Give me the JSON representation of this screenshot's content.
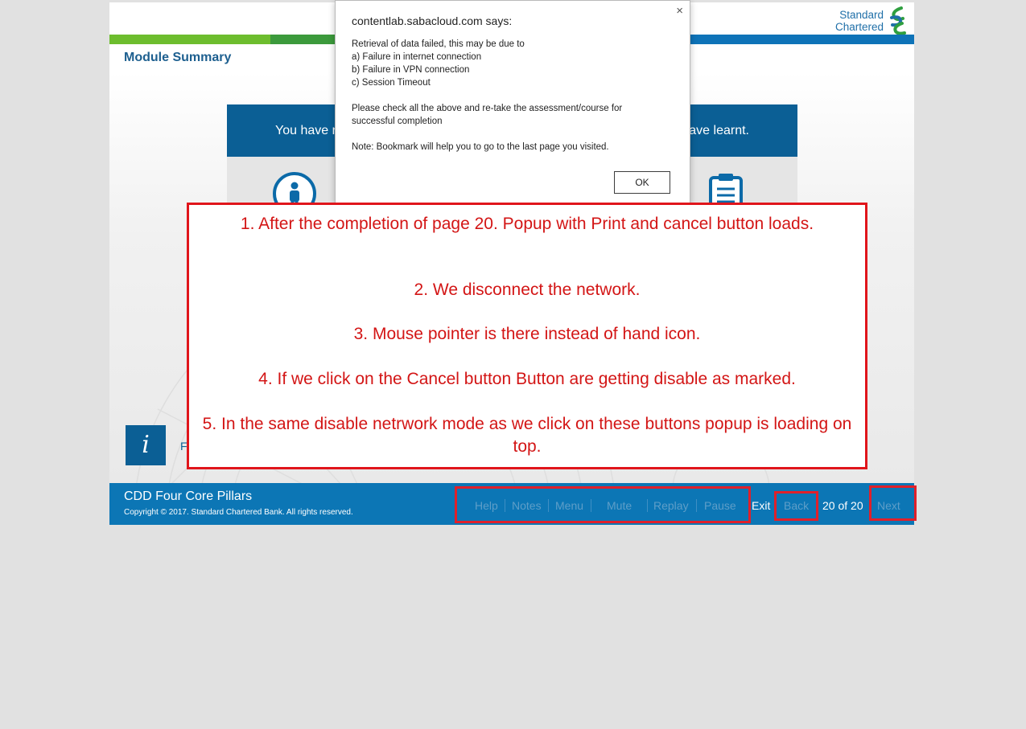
{
  "header": {
    "logo_line1": "Standard",
    "logo_line2": "Chartered",
    "module_title": "Module Summary"
  },
  "content": {
    "banner_left": "You have r",
    "banner_right": "ave learnt.",
    "info_glyph": "i",
    "info_text_fragment": "F"
  },
  "footer": {
    "course_name": "CDD Four Core Pillars",
    "copyright": "Copyright © 2017. Standard Chartered Bank. All rights reserved.",
    "nav": {
      "help": "Help",
      "notes": "Notes",
      "menu": "Menu",
      "mute": "Mute",
      "replay": "Replay",
      "pause": "Pause",
      "exit": "Exit",
      "back": "Back",
      "page_counter": "20 of 20",
      "next": "Next"
    }
  },
  "dialog": {
    "title": "contentlab.sabacloud.com says:",
    "close": "×",
    "message_lines": [
      "Retrieval of data failed, this may be due to",
      "a) Failure in internet connection",
      "b) Failure in VPN connection",
      "c) Session Timeout",
      "",
      "Please check all the above and re-take the assessment/course for",
      "successful completion",
      "",
      "Note: Bookmark will help you to go to the last page you visited."
    ],
    "ok_label": "OK"
  },
  "annotation": {
    "items": [
      "1. After the completion of page 20. Popup with Print and cancel button loads.",
      "2. We disconnect the network.",
      "3. Mouse pointer is there instead of hand icon.",
      "4. If we click on the Cancel button Button are getting disable as marked.",
      "5. In the same disable netrwork mode as we click on these buttons popup is loading on top."
    ]
  },
  "colors": {
    "brand_blue": "#0c76b5",
    "dark_blue": "#0b5f95",
    "green": "#6dbd2e",
    "annotation_red": "#e0151b",
    "disabled_nav": "#5e9ec8"
  }
}
